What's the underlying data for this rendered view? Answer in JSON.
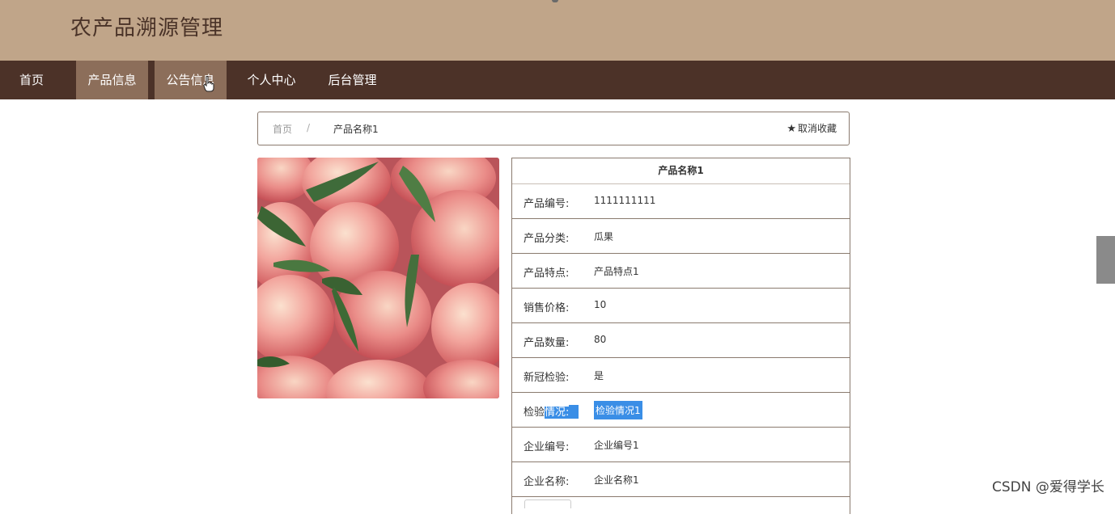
{
  "site": {
    "title": "农产品溯源管理"
  },
  "nav": {
    "items": [
      {
        "label": "首页"
      },
      {
        "label": "产品信息"
      },
      {
        "label": "公告信息"
      },
      {
        "label": "个人中心"
      },
      {
        "label": "后台管理"
      }
    ],
    "active_indices": [
      1,
      2
    ]
  },
  "breadcrumb": {
    "home": "首页",
    "separator": "/",
    "current": "产品名称1"
  },
  "favorite": {
    "icon": "star-icon",
    "label": "取消收藏"
  },
  "product": {
    "title": "产品名称1",
    "image_alt_icon": "peach-photo",
    "fields": [
      {
        "label": "产品编号:",
        "value": "1111111111"
      },
      {
        "label": "产品分类:",
        "value": "瓜果"
      },
      {
        "label": "产品特点:",
        "value": "产品特点1"
      },
      {
        "label": "销售价格:",
        "value": "10"
      },
      {
        "label": "产品数量:",
        "value": "80"
      },
      {
        "label": "新冠检验:",
        "value": "是"
      },
      {
        "label_plain": "检验",
        "label_selected": "情况:",
        "value": "检验情况1"
      },
      {
        "label": "企业编号:",
        "value": "企业编号1"
      },
      {
        "label": "企业名称:",
        "value": "企业名称1"
      }
    ]
  },
  "watermark": "CSDN @爱得学长",
  "colors": {
    "header_bg": "#c0a589",
    "nav_bg": "#4c3228",
    "nav_active": "#8c6e5a",
    "selection": "#3a8ee6"
  }
}
